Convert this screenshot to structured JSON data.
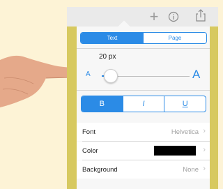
{
  "toolbar": {
    "plus_icon": "plus-icon",
    "info_icon": "info-icon",
    "share_icon": "share-icon"
  },
  "popover": {
    "tabs": [
      {
        "label": "Text",
        "active": true
      },
      {
        "label": "Page",
        "active": false
      }
    ],
    "font_size_label": "20 px",
    "slider": {
      "small_label": "A",
      "large_label": "A",
      "value_fraction": 0.1
    },
    "style_buttons": [
      {
        "label": "B",
        "active": true
      },
      {
        "label": "I",
        "active": false
      },
      {
        "label": "U",
        "active": false
      }
    ],
    "rows": {
      "font": {
        "label": "Font",
        "value": "Helvetica"
      },
      "color": {
        "label": "Color",
        "swatch": "#000000"
      },
      "background": {
        "label": "Background",
        "value": "None"
      }
    }
  },
  "colors": {
    "accent": "#2b8be6",
    "page_bg": "#fdf3d6",
    "doc_yellow": "#d7c95f"
  }
}
